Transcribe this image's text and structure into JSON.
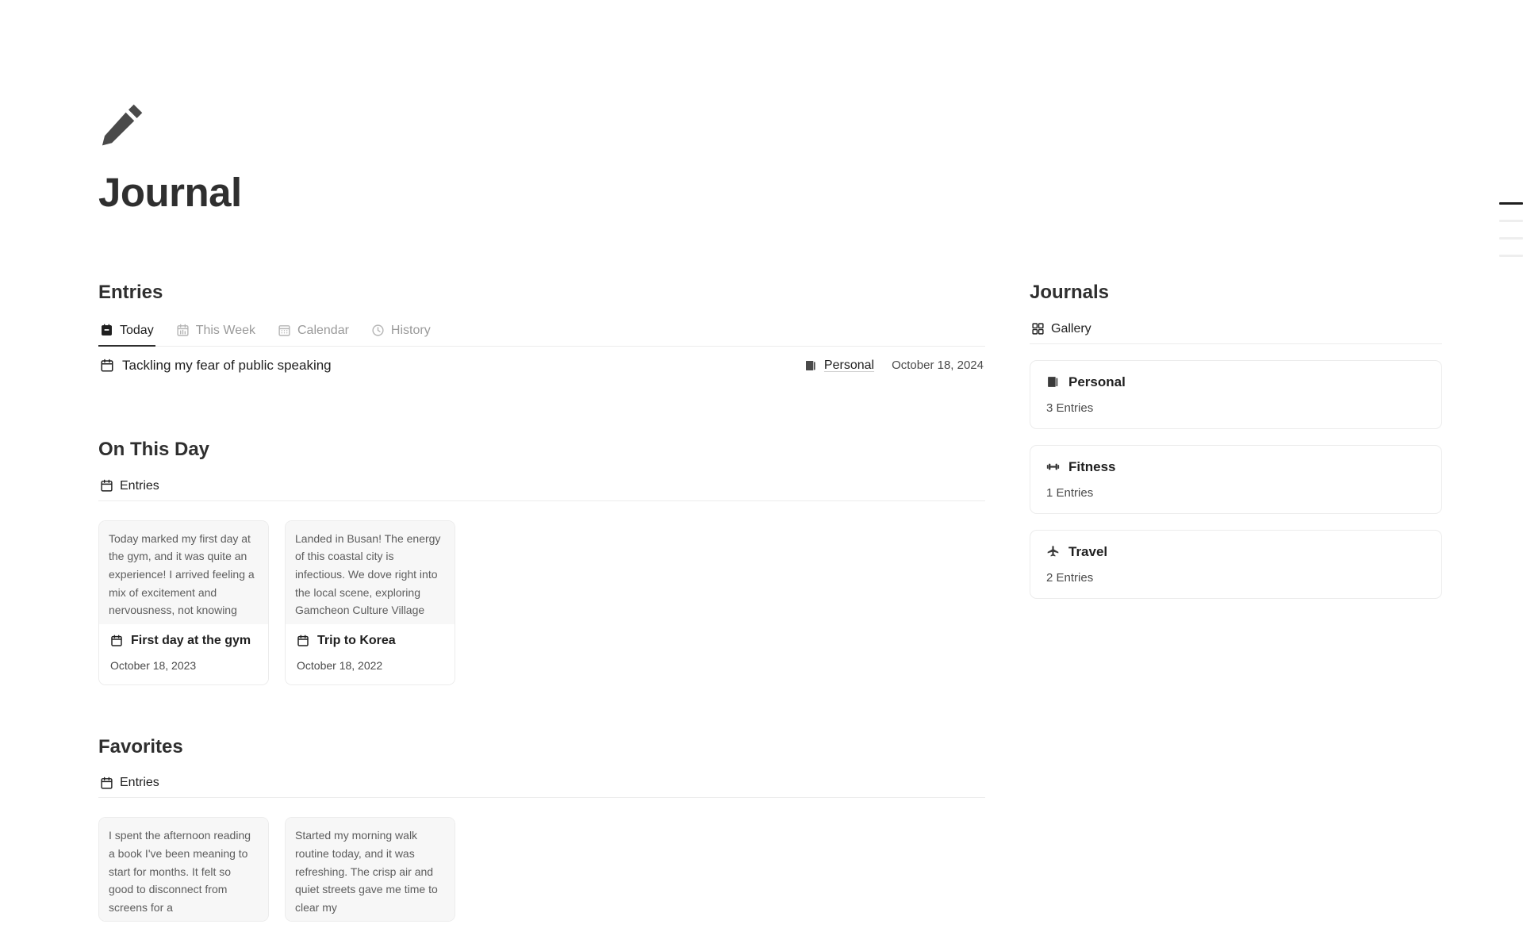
{
  "app": {
    "title": "Journal",
    "header_icon": "pencil-icon"
  },
  "entries_section": {
    "heading": "Entries",
    "tabs": [
      {
        "label": "Today",
        "icon": "calendar-filled-icon",
        "active": true
      },
      {
        "label": "This Week",
        "icon": "calendar-week-icon",
        "active": false
      },
      {
        "label": "Calendar",
        "icon": "calendar-grid-icon",
        "active": false
      },
      {
        "label": "History",
        "icon": "clock-icon",
        "active": false
      }
    ],
    "rows": [
      {
        "icon": "calendar-icon",
        "title": "Tackling my fear of public speaking",
        "journal_icon": "book-icon",
        "journal": "Personal",
        "date": "October 18, 2024"
      }
    ]
  },
  "on_this_day": {
    "heading": "On This Day",
    "subtab": {
      "label": "Entries",
      "icon": "calendar-icon"
    },
    "cards": [
      {
        "preview": "Today marked my first day at the gym, and it was quite an experience! I arrived feeling a mix of excitement and nervousness, not knowing exactly what to expect. The",
        "icon": "calendar-icon",
        "title": "First day at the gym",
        "date": "October 18, 2023"
      },
      {
        "preview": "Landed in Busan! The energy of this coastal city is infectious. We dove right into the local scene, exploring Gamcheon Culture Village with its vibrant, colorful houses cascading down",
        "icon": "calendar-icon",
        "title": "Trip to Korea",
        "date": "October 18, 2022"
      }
    ]
  },
  "favorites": {
    "heading": "Favorites",
    "subtab": {
      "label": "Entries",
      "icon": "calendar-icon"
    },
    "cards": [
      {
        "preview": "I spent the afternoon reading a book I've been meaning to start for months. It felt so good to disconnect from screens for a"
      },
      {
        "preview": "Started my morning walk routine today, and it was refreshing. The crisp air and quiet streets gave me time to clear my"
      }
    ]
  },
  "journals_section": {
    "heading": "Journals",
    "subtab": {
      "label": "Gallery",
      "icon": "grid-icon"
    },
    "cards": [
      {
        "icon": "book-icon",
        "title": "Personal",
        "count": "3 Entries"
      },
      {
        "icon": "dumbbell-icon",
        "title": "Fitness",
        "count": "1 Entries"
      },
      {
        "icon": "airplane-icon",
        "title": "Travel",
        "count": "2 Entries"
      }
    ]
  },
  "page_indicator": {
    "total": 4,
    "active_index": 0
  },
  "colors": {
    "text_primary": "#2f2f2f",
    "text_muted": "#9a9a9a",
    "border": "#ececec",
    "preview_bg": "#f7f7f7",
    "background": "#ffffff"
  }
}
